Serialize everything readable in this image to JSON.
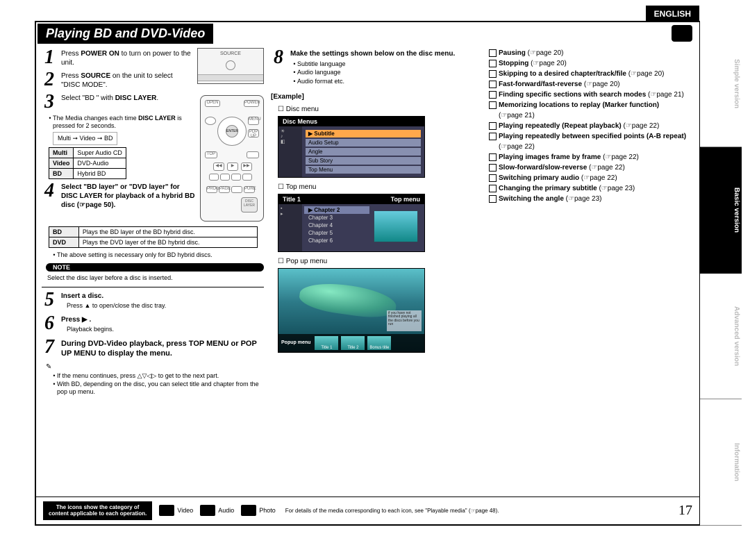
{
  "language": "ENGLISH",
  "heading": "Playing BD and DVD-Video",
  "pageNumber": "17",
  "sidebar": {
    "tabs": [
      "Simple version",
      "Basic version",
      "Advanced version",
      "Information"
    ],
    "activeIndex": 1
  },
  "col1": {
    "steps": {
      "s1": {
        "num": "1",
        "text_a": "Press ",
        "b1": "POWER ON",
        "text_b": " to turn on power to the unit."
      },
      "s2": {
        "num": "2",
        "text_a": "Press ",
        "b1": "SOURCE",
        "text_b": " on the unit to select \"DISC MODE\"."
      },
      "s3": {
        "num": "3",
        "text_a": "Select \"BD \" with ",
        "b1": "DISC LAYER",
        "text_b": "."
      },
      "s4": {
        "num": "4",
        "text_a": "Select \"BD layer\" or \"DVD layer\" for ",
        "b1": "DISC LAYER",
        "text_b": " for playback of a hybrid BD disc (☞page 50)."
      },
      "s5": {
        "num": "5",
        "b1": "Insert a disc.",
        "sub": "Press ▲ to open/close the disc tray."
      },
      "s6": {
        "num": "6",
        "b1": "Press ▶ .",
        "sub": "Playback begins."
      },
      "s7": {
        "num": "7",
        "text_a": "During DVD-Video playback, press ",
        "b1": "TOP MENU",
        "text_b": " or ",
        "b2": "POP UP MENU",
        "text_c": " to display the menu."
      }
    },
    "mediaNote_a": "The Media changes each time ",
    "mediaNote_b": "DISC LAYER",
    "mediaNote_c": " is pressed for 2 seconds.",
    "mediaFlow": "Multi ➞ Video ➞ BD",
    "mediaTable": {
      "r1": {
        "k": "Multi",
        "v": "Super Audio CD"
      },
      "r2": {
        "k": "Video",
        "v": "DVD-Audio"
      },
      "r3": {
        "k": "BD",
        "v": "Hybrid BD"
      }
    },
    "layerTable": {
      "r1": {
        "k": "BD",
        "v": "Plays the BD layer of the BD hybrid disc."
      },
      "r2": {
        "k": "DVD",
        "v": "Plays the DVD layer of the BD hybrid disc."
      }
    },
    "layerNote": "The above setting is necessary only for BD hybrid discs.",
    "noteLabel": "NOTE",
    "noteText": "Select the disc layer before a disc is inserted.",
    "afterStep7_1": "If the menu continues, press △▽◁▷ to get to the next part.",
    "afterStep7_2": "With BD, depending on the disc, you can select title and chapter from the pop up menu.",
    "device": {
      "label": "SOURCE"
    }
  },
  "col2": {
    "step8": {
      "num": "8",
      "b1": "Make the settings shown below on the disc menu."
    },
    "step8_bullets": [
      "Subtitle language",
      "Audio language",
      "Audio format etc."
    ],
    "exampleLabel": "[Example]",
    "discMenuLabel": "Disc menu",
    "discMenus": {
      "title": "Disc Menus",
      "items": [
        "Subtitle",
        "Audio Setup",
        "Angle",
        "Sub Story",
        "Top Menu"
      ],
      "activeItem": "Subtitle"
    },
    "topMenuLabel": "Top menu",
    "topMenu": {
      "titleLeft": "Title 1",
      "titleRight": "Top menu",
      "chapters": [
        "Chapter 2",
        "Chapter 3",
        "Chapter 4",
        "Chapter 5",
        "Chapter 6"
      ],
      "activeChapter": "Chapter 2"
    },
    "popupLabel": "Pop up menu",
    "popup": {
      "label": "Popup menu",
      "thumbs": [
        "Title 1",
        "Title 2",
        "Bonus title"
      ]
    }
  },
  "col3": {
    "items": [
      {
        "b": "Pausing",
        "page": " (☞page 20)"
      },
      {
        "b": "Stopping",
        "page": " (☞page 20)"
      },
      {
        "b": "Skipping to a desired chapter/track/file",
        "page": " (☞page 20)"
      },
      {
        "b": "Fast-forward/fast-reverse",
        "page": " (☞page 20)"
      },
      {
        "b": "Finding specific sections with search modes",
        "page": " (☞page 21)"
      },
      {
        "b": "Memorizing locations to replay (Marker function)",
        "page": "(☞page 21)"
      },
      {
        "b": "Playing repeatedly (Repeat playback)",
        "page": " (☞page 22)"
      },
      {
        "b": "Playing repeatedly between specified points (A-B repeat)",
        "page": "(☞page 22)"
      },
      {
        "b": "Playing images frame by frame",
        "page": " (☞page 22)"
      },
      {
        "b": "Slow-forward/slow-reverse",
        "page": " (☞page 22)"
      },
      {
        "b": "Switching primary audio",
        "page": " (☞page 22)"
      },
      {
        "b": "Changing the primary subtitle",
        "page": " (☞page 23)"
      },
      {
        "b": "Switching the angle",
        "page": " (☞page 23)"
      }
    ]
  },
  "footer": {
    "black1": "The icons show the category of",
    "black2": "content applicable to each operation.",
    "videoLabel": "Video",
    "audioLabel": "Audio",
    "photoLabel": "Photo",
    "note": "For details of the media corresponding to each icon, see \"Playable media\" (☞page 48)."
  }
}
